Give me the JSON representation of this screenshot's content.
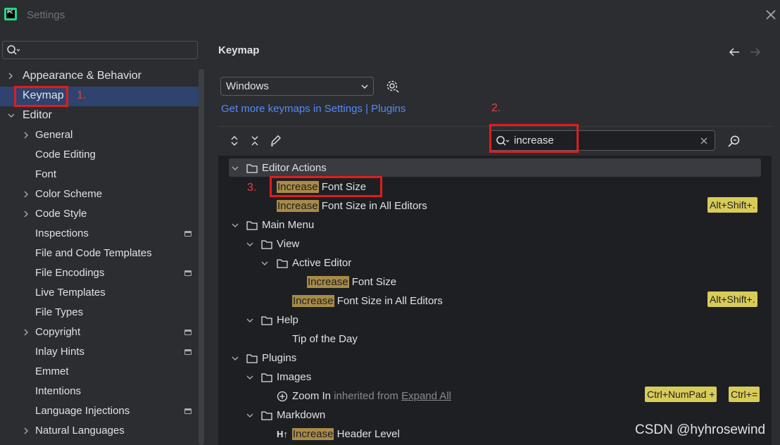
{
  "window": {
    "title": "Settings"
  },
  "sidebar": {
    "items": [
      {
        "label": "Appearance & Behavior"
      },
      {
        "label": "Keymap"
      },
      {
        "label": "Editor"
      },
      {
        "label": "General"
      },
      {
        "label": "Code Editing"
      },
      {
        "label": "Font"
      },
      {
        "label": "Color Scheme"
      },
      {
        "label": "Code Style"
      },
      {
        "label": "Inspections"
      },
      {
        "label": "File and Code Templates"
      },
      {
        "label": "File Encodings"
      },
      {
        "label": "Live Templates"
      },
      {
        "label": "File Types"
      },
      {
        "label": "Copyright"
      },
      {
        "label": "Inlay Hints"
      },
      {
        "label": "Emmet"
      },
      {
        "label": "Intentions"
      },
      {
        "label": "Language Injections"
      },
      {
        "label": "Natural Languages"
      }
    ]
  },
  "annotations": {
    "step1": "1.",
    "step2": "2.",
    "step3": "3."
  },
  "main": {
    "title": "Keymap",
    "keymap_select": "Windows",
    "link_settings": "Get more keymaps in Settings",
    "link_sep": "|",
    "link_plugins": "Plugins",
    "search_value": "increase",
    "tree": {
      "editor_actions": "Editor Actions",
      "hl": "Increase",
      "font_size": "Font Size",
      "font_size_all": "Font Size in All Editors",
      "main_menu": "Main Menu",
      "view": "View",
      "active_editor": "Active Editor",
      "help": "Help",
      "tip_of_day": "Tip of the Day",
      "plugins": "Plugins",
      "images": "Images",
      "zoom_in": "Zoom In",
      "inherited": "inherited from",
      "expand_all": "Expand All",
      "markdown": "Markdown",
      "header_level": "Header Level",
      "header_icon_text": "H↑"
    },
    "shortcuts": {
      "alt_shift_dot": "Alt+Shift+.",
      "ctrl_numpad": "Ctrl+NumPad +",
      "ctrl_eq": "Ctrl+="
    }
  },
  "watermark": "CSDN @hyhrosewind",
  "colors": {
    "accent": "#548af7",
    "selection": "#2e436e",
    "highlight": "#a88b46",
    "shortcut": "#d8cc58",
    "annotation": "#e01d1d"
  }
}
